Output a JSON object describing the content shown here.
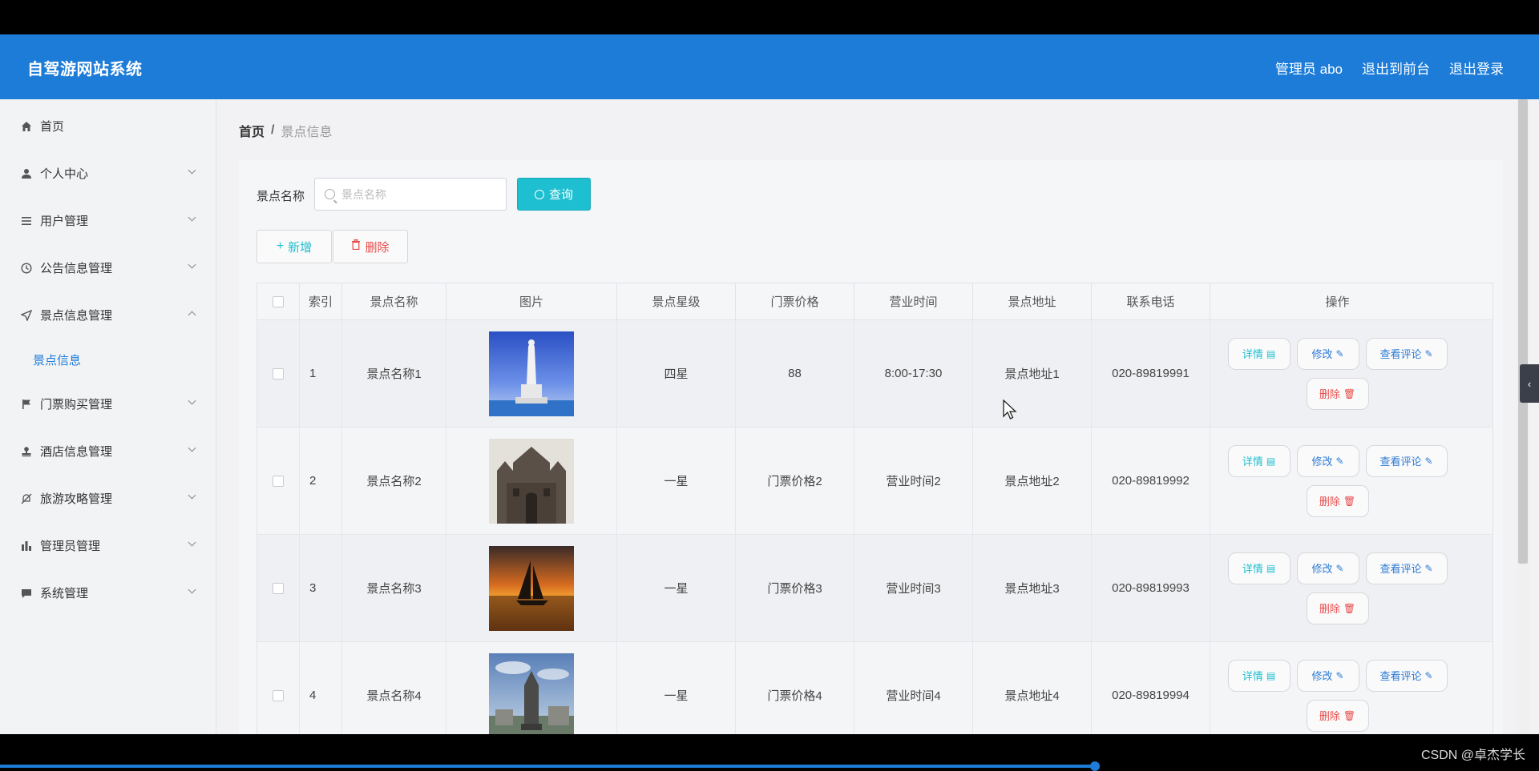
{
  "header": {
    "title": "自驾游网站系统",
    "admin": "管理员 abo",
    "exit_front": "退出到前台",
    "logout": "退出登录"
  },
  "sidebar": {
    "items": [
      {
        "label": "首页",
        "icon": "home-icon"
      },
      {
        "label": "个人中心",
        "icon": "user-icon"
      },
      {
        "label": "用户管理",
        "icon": "list-icon"
      },
      {
        "label": "公告信息管理",
        "icon": "clock-icon"
      },
      {
        "label": "景点信息管理",
        "icon": "send-icon"
      },
      {
        "label": "门票购买管理",
        "icon": "flag-icon"
      },
      {
        "label": "酒店信息管理",
        "icon": "stamp-icon"
      },
      {
        "label": "旅游攻略管理",
        "icon": "bell-off-icon"
      },
      {
        "label": "管理员管理",
        "icon": "bar-chart-icon"
      },
      {
        "label": "系统管理",
        "icon": "comment-icon"
      }
    ],
    "sub_item": "景点信息"
  },
  "breadcrumb": {
    "home": "首页",
    "separator": "/",
    "current": "景点信息"
  },
  "search": {
    "label": "景点名称",
    "placeholder": "景点名称",
    "button": "查询"
  },
  "actions": {
    "add": "新增",
    "delete": "删除"
  },
  "table": {
    "headers": [
      "索引",
      "景点名称",
      "图片",
      "景点星级",
      "门票价格",
      "营业时间",
      "景点地址",
      "联系电话",
      "操作"
    ],
    "rows": [
      {
        "index": "1",
        "name": "景点名称1",
        "star": "四星",
        "price": "88",
        "time": "8:00-17:30",
        "address": "景点地址1",
        "phone": "020-89819991"
      },
      {
        "index": "2",
        "name": "景点名称2",
        "star": "一星",
        "price": "门票价格2",
        "time": "营业时间2",
        "address": "景点地址2",
        "phone": "020-89819992"
      },
      {
        "index": "3",
        "name": "景点名称3",
        "star": "一星",
        "price": "门票价格3",
        "time": "营业时间3",
        "address": "景点地址3",
        "phone": "020-89819993"
      },
      {
        "index": "4",
        "name": "景点名称4",
        "star": "一星",
        "price": "门票价格4",
        "time": "营业时间4",
        "address": "景点地址4",
        "phone": "020-89819994"
      }
    ],
    "ops": {
      "detail": "详情",
      "edit": "修改",
      "review": "查看评论",
      "delete": "删除"
    }
  },
  "watermark": "CSDN @卓杰学长",
  "colors": {
    "header_bg": "#1c7cd8",
    "accent_cyan": "#1ebfd0",
    "danger": "#e84a4a"
  }
}
